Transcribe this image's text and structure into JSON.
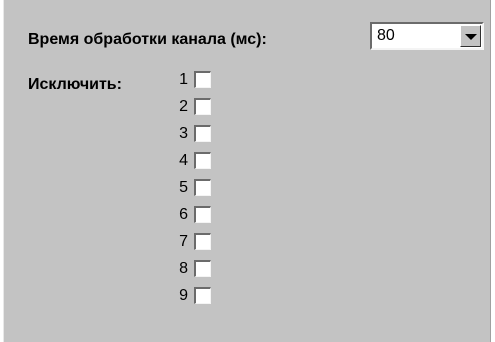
{
  "processing_time": {
    "label": "Время обработки канала (мс):",
    "selected_value": "80"
  },
  "exclude": {
    "label": "Исключить:",
    "channels": [
      {
        "number": "1",
        "checked": false
      },
      {
        "number": "2",
        "checked": false
      },
      {
        "number": "3",
        "checked": false
      },
      {
        "number": "4",
        "checked": false
      },
      {
        "number": "5",
        "checked": false
      },
      {
        "number": "6",
        "checked": false
      },
      {
        "number": "7",
        "checked": false
      },
      {
        "number": "8",
        "checked": false
      },
      {
        "number": "9",
        "checked": false
      }
    ]
  },
  "icons": {
    "dropdown": "chevron-down-icon"
  },
  "colors": {
    "panel_background": "#c3c3c3",
    "field_background": "#ffffff"
  }
}
